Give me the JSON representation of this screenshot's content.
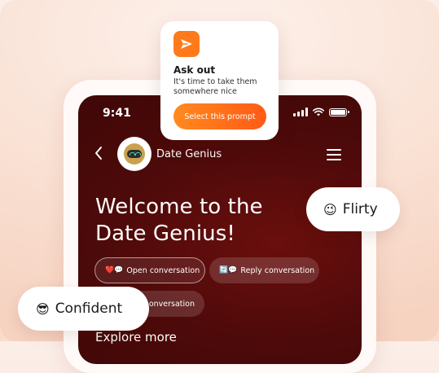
{
  "status_bar": {
    "time": "9:41"
  },
  "chat_header": {
    "title": "Date Genius",
    "avatar_icon": "robot-face-icon"
  },
  "welcome": {
    "heading": "Welcome to the Date Genius!"
  },
  "prompt_chips": [
    {
      "emoji": "❤️💬",
      "label": "Open conversation"
    },
    {
      "emoji": "🔄💬",
      "label": "Reply conversation"
    },
    {
      "label": "onversation"
    }
  ],
  "explore": {
    "label": "Explore more"
  },
  "prompt_card": {
    "title": "Ask out",
    "description": "It's time to take them somewhere nice",
    "button_label": "Select this prompt",
    "accent_color": "#ff7a1a"
  },
  "moods": [
    {
      "emoji": "😉",
      "label": "Flirty"
    },
    {
      "emoji": "😎",
      "label": "Confident"
    }
  ],
  "colors": {
    "screen_bg": "#4e0a0a",
    "accent": "#ff6a1a",
    "page_bg": "#f9dfd1"
  }
}
